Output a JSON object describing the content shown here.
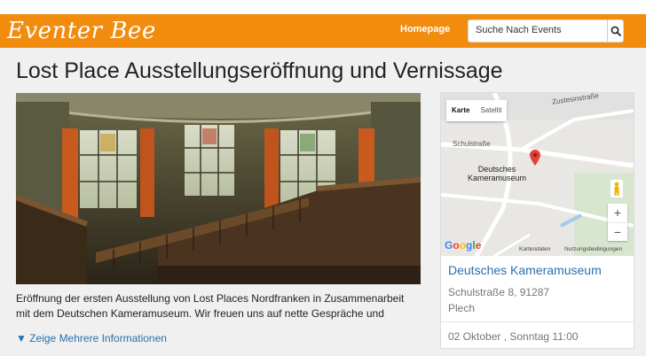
{
  "navbar": {
    "logo": "Eventer Bee",
    "home_link": "Homepage",
    "search_placeholder": "Suche Nach Events"
  },
  "event": {
    "title": "Lost Place Ausstellungseröffnung und Vernissage",
    "description": "Eröffnung der ersten Ausstellung von Lost Places Nordfranken in Zusammenarbeit mit dem Deutschen Kameramuseum. Wir freuen uns auf nette Gespräche und",
    "more_link": "▼ Zeige Mehrere Informationen"
  },
  "map": {
    "toggle_map": "Karte",
    "toggle_satellite": "Satellit",
    "street_1": "Schulstraße",
    "street_2": "Zustesinstraße",
    "place_line1": "Deutsches",
    "place_line2": "Kameramuseum",
    "zoom_in": "+",
    "zoom_out": "−",
    "footer_data": "Kartendaten",
    "footer_terms": "Nutzungsbedingungen",
    "google_letters": [
      "G",
      "o",
      "o",
      "g",
      "l",
      "e"
    ]
  },
  "venue": {
    "name": "Deutsches Kameramuseum",
    "address_line1": "Schulstraße 8, 91287",
    "address_line2": "Plech",
    "datetime": "02 Oktober , Sonntag 11:00"
  },
  "colors": {
    "navbar": "#f28c0f",
    "link": "#2a6fae",
    "map_pin": "#e2403a"
  },
  "icons": {
    "search": "search-icon",
    "pin": "map-pin-icon",
    "pegman": "pegman-icon"
  }
}
